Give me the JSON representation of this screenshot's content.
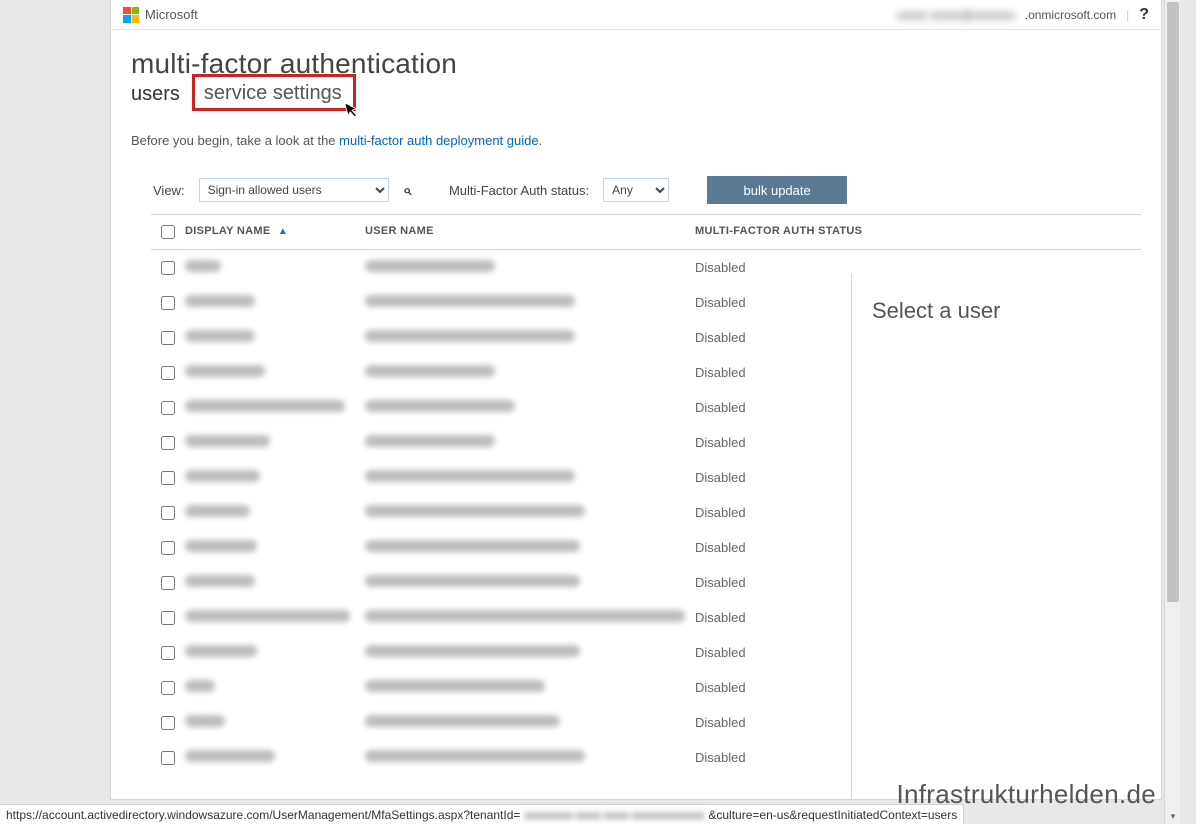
{
  "topbar": {
    "brand": "Microsoft",
    "account_blur": "xxxxx xxxxx@xxxxxxx",
    "account_domain": ".onmicrosoft.com",
    "separator": "|",
    "help": "?"
  },
  "heading": {
    "title": "multi-factor authentication",
    "tabs": {
      "users": "users",
      "service_settings": "service settings"
    }
  },
  "intro": {
    "before": "Before you begin, take a look at the ",
    "link": "multi-factor auth deployment guide",
    "after": "."
  },
  "filters": {
    "view_label": "View:",
    "view_value": "Sign-in allowed users",
    "mfa_label": "Multi-Factor Auth status:",
    "mfa_value": "Any",
    "bulk_label": "bulk update"
  },
  "table": {
    "headers": {
      "display_name": "DISPLAY NAME",
      "user_name": "USER NAME",
      "mfa_status": "MULTI-FACTOR AUTH STATUS"
    },
    "rows": [
      {
        "nw": 36,
        "uw": 130,
        "status": "Disabled"
      },
      {
        "nw": 70,
        "uw": 210,
        "status": "Disabled"
      },
      {
        "nw": 70,
        "uw": 210,
        "status": "Disabled"
      },
      {
        "nw": 80,
        "uw": 130,
        "status": "Disabled"
      },
      {
        "nw": 160,
        "uw": 150,
        "status": "Disabled"
      },
      {
        "nw": 85,
        "uw": 130,
        "status": "Disabled"
      },
      {
        "nw": 75,
        "uw": 210,
        "status": "Disabled"
      },
      {
        "nw": 65,
        "uw": 220,
        "status": "Disabled"
      },
      {
        "nw": 72,
        "uw": 215,
        "status": "Disabled"
      },
      {
        "nw": 70,
        "uw": 215,
        "status": "Disabled"
      },
      {
        "nw": 165,
        "uw": 320,
        "status": "Disabled"
      },
      {
        "nw": 72,
        "uw": 215,
        "status": "Disabled"
      },
      {
        "nw": 30,
        "uw": 180,
        "status": "Disabled"
      },
      {
        "nw": 40,
        "uw": 195,
        "status": "Disabled"
      },
      {
        "nw": 90,
        "uw": 220,
        "status": "Disabled"
      }
    ]
  },
  "side_panel": {
    "title": "Select a user"
  },
  "watermark": "Infrastrukturhelden.de",
  "status_url": {
    "p1": "https://account.activedirectory.windowsazure.com/UserManagement/MfaSettings.aspx?tenantId=",
    "blur": "xxxxxxxx-xxxx-xxxx-xxxxxxxxxxxx",
    "p2": "&culture=en-us&requestInitiatedContext=users"
  }
}
